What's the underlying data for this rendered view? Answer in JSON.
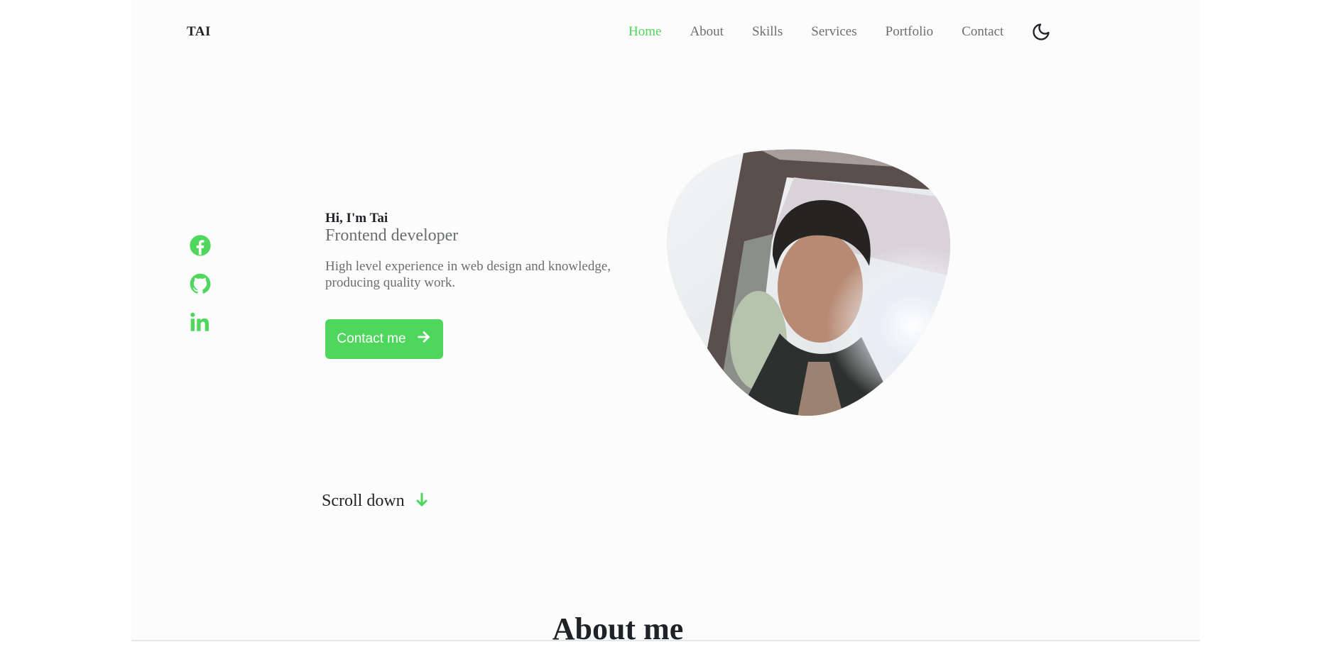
{
  "header": {
    "logo": "TAI",
    "nav": [
      "Home",
      "About",
      "Skills",
      "Services",
      "Portfolio",
      "Contact"
    ],
    "active_nav": "Home",
    "theme_icon": "moon-icon"
  },
  "social": {
    "icons": [
      "facebook-icon",
      "github-icon",
      "linkedin-icon"
    ]
  },
  "hero": {
    "greeting": "Hi, I'm Tai",
    "role": "Frontend developer",
    "description": "High level experience in web design and knowledge, producing quality work.",
    "contact_label": "Contact me"
  },
  "scroll": {
    "label": "Scroll down"
  },
  "about": {
    "title": "About me"
  },
  "colors": {
    "accent": "#4fd65c",
    "text": "#1f2226",
    "muted": "#6a6f6d",
    "background": "#fbfcfb"
  }
}
